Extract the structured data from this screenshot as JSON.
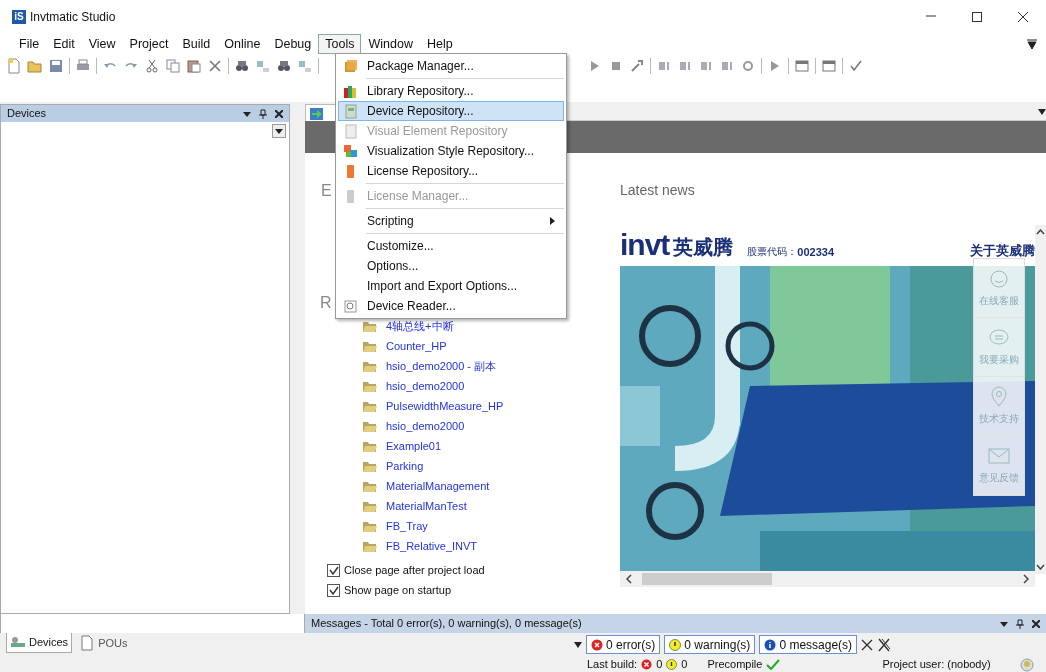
{
  "window": {
    "logo_text": "iS",
    "title": "Invtmatic Studio"
  },
  "menubar": [
    {
      "label": "File",
      "selected": false
    },
    {
      "label": "Edit",
      "selected": false
    },
    {
      "label": "View",
      "selected": false
    },
    {
      "label": "Project",
      "selected": false
    },
    {
      "label": "Build",
      "selected": false
    },
    {
      "label": "Online",
      "selected": false
    },
    {
      "label": "Debug",
      "selected": false
    },
    {
      "label": "Tools",
      "selected": true
    },
    {
      "label": "Window",
      "selected": false
    },
    {
      "label": "Help",
      "selected": false
    }
  ],
  "tools_menu": [
    {
      "kind": "item",
      "label": "Package Manager...",
      "disabled": false,
      "selected": false
    },
    {
      "kind": "separator"
    },
    {
      "kind": "item",
      "label": "Library Repository...",
      "disabled": false,
      "selected": false
    },
    {
      "kind": "item",
      "label": "Device Repository...",
      "disabled": false,
      "selected": true
    },
    {
      "kind": "item",
      "label": "Visual Element Repository",
      "disabled": true,
      "selected": false
    },
    {
      "kind": "item",
      "label": "Visualization Style Repository...",
      "disabled": false,
      "selected": false
    },
    {
      "kind": "item",
      "label": "License Repository...",
      "disabled": false,
      "selected": false
    },
    {
      "kind": "separator"
    },
    {
      "kind": "item",
      "label": "License Manager...",
      "disabled": true,
      "selected": false
    },
    {
      "kind": "separator"
    },
    {
      "kind": "submenu",
      "label": "Scripting",
      "disabled": false,
      "selected": false
    },
    {
      "kind": "separator"
    },
    {
      "kind": "item",
      "label": "Customize...",
      "disabled": false,
      "selected": false
    },
    {
      "kind": "item",
      "label": "Options...",
      "disabled": false,
      "selected": false
    },
    {
      "kind": "item",
      "label": "Import and Export Options...",
      "disabled": false,
      "selected": false
    },
    {
      "kind": "item",
      "label": "Device Reader...",
      "disabled": false,
      "selected": false
    }
  ],
  "devices_panel": {
    "title": "Devices"
  },
  "start_page": {
    "headings": [
      "E",
      "R"
    ],
    "recent_projects": [
      "4轴总线+中断",
      "Counter_HP",
      "hsio_demo2000 - 副本",
      "hsio_demo2000",
      "PulsewidthMeasure_HP",
      "hsio_demo2000",
      "Example01",
      "Parking",
      "MaterialManagement",
      "MaterialManTest",
      "FB_Tray",
      "FB_Relative_INVT"
    ],
    "options": [
      {
        "label": "Close page after project load",
        "checked": true
      },
      {
        "label": "Show page on startup",
        "checked": true
      }
    ]
  },
  "news": {
    "heading": "Latest news",
    "logo_word": "invt",
    "logo_name": "英威腾",
    "stock_label": "股票代码：",
    "stock_code": "002334",
    "about": "关于英威腾",
    "side_widgets": [
      "在线客服",
      "我要采购",
      "技术支持",
      "意见反馈"
    ]
  },
  "left_tabs": [
    {
      "label": "Devices",
      "selected": true
    },
    {
      "label": "POUs",
      "selected": false
    }
  ],
  "messages": {
    "title": "Messages - Total 0 error(s), 0 warning(s), 0 message(s)",
    "filters": [
      {
        "kind": "error",
        "label": "0 error(s)"
      },
      {
        "kind": "warning",
        "label": "0 warning(s)"
      },
      {
        "kind": "message",
        "label": "0 message(s)"
      }
    ]
  },
  "status_bar": {
    "last_build": "Last build:",
    "errors": "0",
    "warnings": "0",
    "precompile": "Precompile",
    "user": "Project user: (nobody)"
  }
}
